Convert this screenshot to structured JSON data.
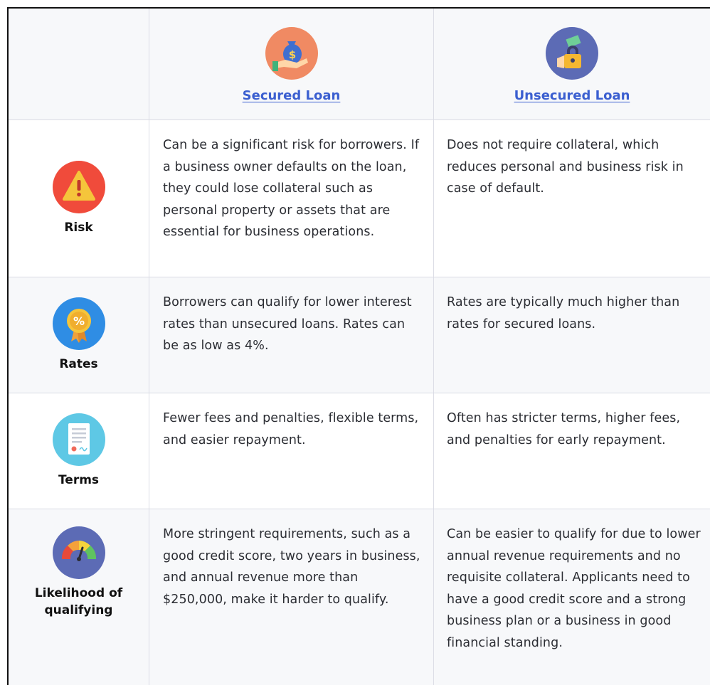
{
  "header": {
    "secured_label": "Secured Loan",
    "unsecured_label": "Unsecured Loan",
    "link_color": "#3b5fd0"
  },
  "rows": [
    {
      "label": "Risk",
      "icon": "warning-icon",
      "secured": "Can be a significant risk for borrowers. If a business owner defaults on the loan, they could lose collateral such as personal property or assets that are essential for business operations.",
      "unsecured": "Does not require collateral, which reduces personal and business risk in case of default."
    },
    {
      "label": "Rates",
      "icon": "percent-badge-icon",
      "secured": "Borrowers can qualify for lower interest rates than unsecured loans. Rates can be as low as 4%.",
      "unsecured": "Rates are typically much higher than rates for secured loans."
    },
    {
      "label": "Terms",
      "icon": "document-icon",
      "secured": "Fewer fees and penalties, flexible terms, and easier repayment.",
      "unsecured": "Often has stricter terms, higher fees, and penalties for early repayment."
    },
    {
      "label": "Likelihood of qualifying",
      "icon": "gauge-icon",
      "secured": "More stringent requirements, such as a good credit score, two years in business, and annual revenue more than $250,000, make it harder to qualify.",
      "unsecured": "Can be easier to qualify for due to lower annual revenue requirements and no requisite collateral. Applicants need to have a good credit score and a strong business plan or a business in good financial standing."
    }
  ]
}
